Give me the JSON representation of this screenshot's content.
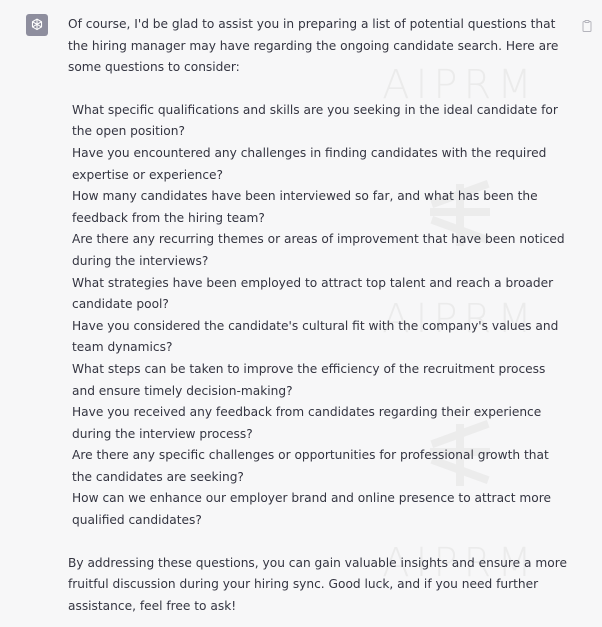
{
  "assistant": {
    "avatar_icon": "openai-logo-icon",
    "copy_icon": "clipboard-icon"
  },
  "message": {
    "intro": "Of course, I'd be glad to assist you in preparing a list of potential questions that the hiring manager may have regarding the ongoing candidate search. Here are some questions to consider:",
    "questions": [
      "What specific qualifications and skills are you seeking in the ideal candidate for the open position?",
      "Have you encountered any challenges in finding candidates with the required expertise or experience?",
      "How many candidates have been interviewed so far, and what has been the feedback from the hiring team?",
      "Are there any recurring themes or areas of improvement that have been noticed during the interviews?",
      "What strategies have been employed to attract top talent and reach a broader candidate pool?",
      "Have you considered the candidate's cultural fit with the company's values and team dynamics?",
      "What steps can be taken to improve the efficiency of the recruitment process and ensure timely decision-making?",
      "Have you received any feedback from candidates regarding their experience during the interview process?",
      "Are there any specific challenges or opportunities for professional growth that the candidates are seeking?",
      "How can we enhance our employer brand and online presence to attract more qualified candidates?"
    ],
    "closing": "By addressing these questions, you can gain valuable insights and ensure a more fruitful discussion during your hiring sync. Good luck, and if you need further assistance, feel free to ask!"
  },
  "watermark": {
    "text": "AIPRM"
  }
}
